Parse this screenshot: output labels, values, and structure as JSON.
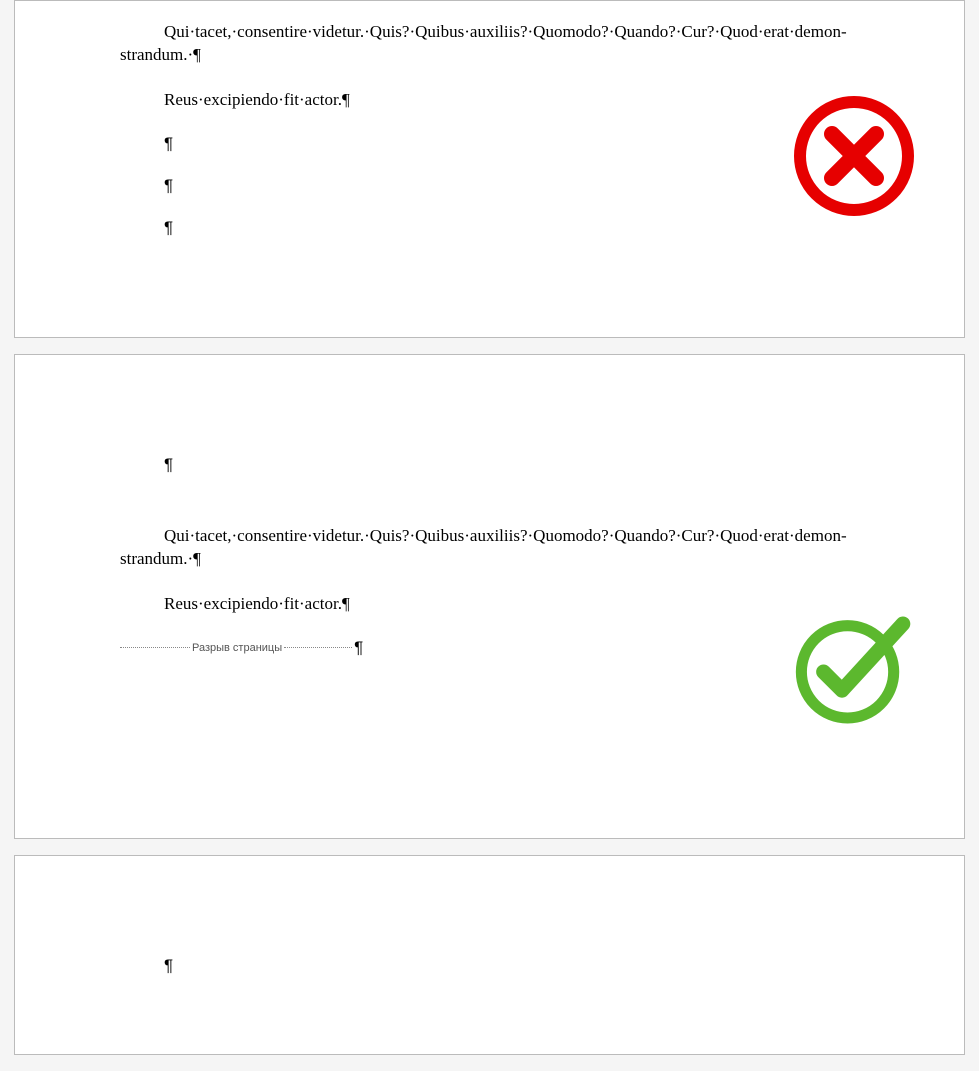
{
  "page1": {
    "para1": "Qui·tacet,·consentire·videtur.·Quis?·Quibus·auxiliis?·Quomodo?·Quando?·Cur?·Quod·erat·demon-strandum.·¶",
    "para2": "Reus·excipiendo·fit·actor.¶",
    "pilcrow": "¶"
  },
  "page2": {
    "pilcrow_top": "¶",
    "para1": "Qui·tacet,·consentire·videtur.·Quis?·Quibus·auxiliis?·Quomodo?·Quando?·Cur?·Quod·erat·demon-strandum.·¶",
    "para2": "Reus·excipiendo·fit·actor.¶",
    "page_break_label": "Разрыв страницы",
    "pilcrow_break": "¶"
  },
  "page3": {
    "pilcrow_top": "¶"
  },
  "badges": {
    "wrong": "wrong-icon",
    "correct": "correct-icon"
  },
  "colors": {
    "red": "#e60000",
    "green": "#5cb82e"
  }
}
